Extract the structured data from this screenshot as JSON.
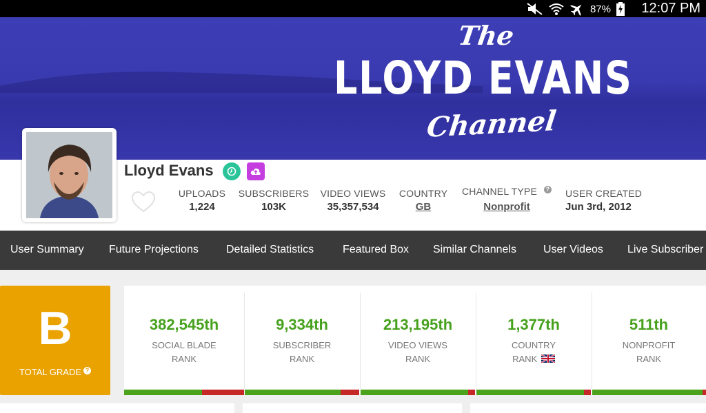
{
  "status_bar": {
    "battery_pct": "87%",
    "clock": "12:07 PM"
  },
  "banner": {
    "logo_the": "The",
    "logo_name": "LLOYD EVANS",
    "logo_channel": "Channel"
  },
  "profile": {
    "channel_name": "Lloyd Evans",
    "stats": [
      {
        "label": "UPLOADS",
        "value": "1,224"
      },
      {
        "label": "SUBSCRIBERS",
        "value": "103K"
      },
      {
        "label": "VIDEO VIEWS",
        "value": "35,357,534"
      },
      {
        "label": "COUNTRY",
        "value": "GB"
      },
      {
        "label": "CHANNEL TYPE",
        "value": "Nonprofit"
      },
      {
        "label": "USER CREATED",
        "value": "Jun 3rd, 2012"
      }
    ]
  },
  "nav": {
    "tabs": [
      "User Summary",
      "Future Projections",
      "Detailed Statistics",
      "Featured Box",
      "Similar Channels",
      "User Videos",
      "Live Subscriber"
    ]
  },
  "grade": {
    "letter": "B",
    "label": "TOTAL GRADE"
  },
  "ranks": [
    {
      "value": "382,545th",
      "line1": "SOCIAL BLADE",
      "line2": "RANK",
      "fill": 0.65
    },
    {
      "value": "9,334th",
      "line1": "SUBSCRIBER",
      "line2": "RANK",
      "fill": 0.84
    },
    {
      "value": "213,195th",
      "line1": "VIDEO VIEWS",
      "line2": "RANK",
      "fill": 0.94
    },
    {
      "value": "1,377th",
      "line1": "COUNTRY",
      "line2": "RANK",
      "fill": 0.94
    },
    {
      "value": "511th",
      "line1": "NONPROFIT",
      "line2": "RANK",
      "fill": 0.97
    }
  ],
  "colors": {
    "grade_bg": "#e9a200",
    "rank_green": "#46a11d",
    "bar_red": "#c62828",
    "nav_bg": "#3a3a3a",
    "banner_blue": "#3a3ab0"
  }
}
